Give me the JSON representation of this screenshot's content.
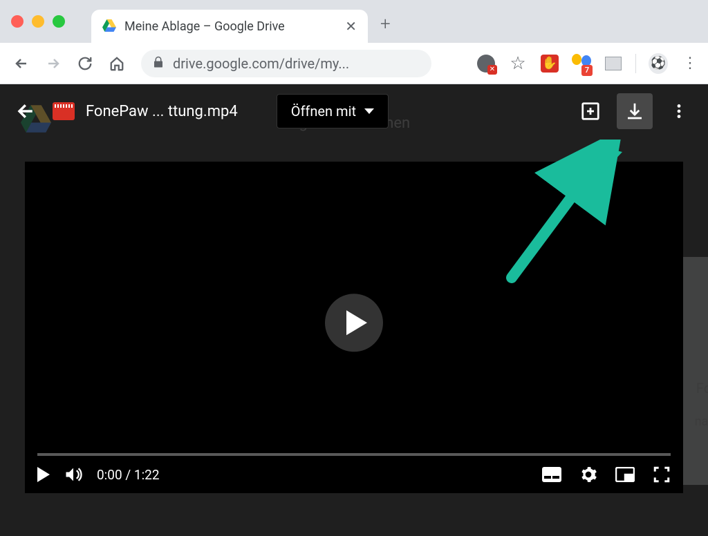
{
  "browser": {
    "tab_title": "Meine Ablage – Google Drive",
    "url": "drive.google.com/drive/my...",
    "extension_badge": "7"
  },
  "viewer": {
    "file_name": "FonePaw ... ttung.mp4",
    "open_with_label": "Öffnen mit",
    "bg_search_hint": "ogle Drive suchen",
    "bg_side_text1": "Foi",
    "bg_side_text2": "nabe"
  },
  "player": {
    "time": "0:00 / 1:22"
  }
}
